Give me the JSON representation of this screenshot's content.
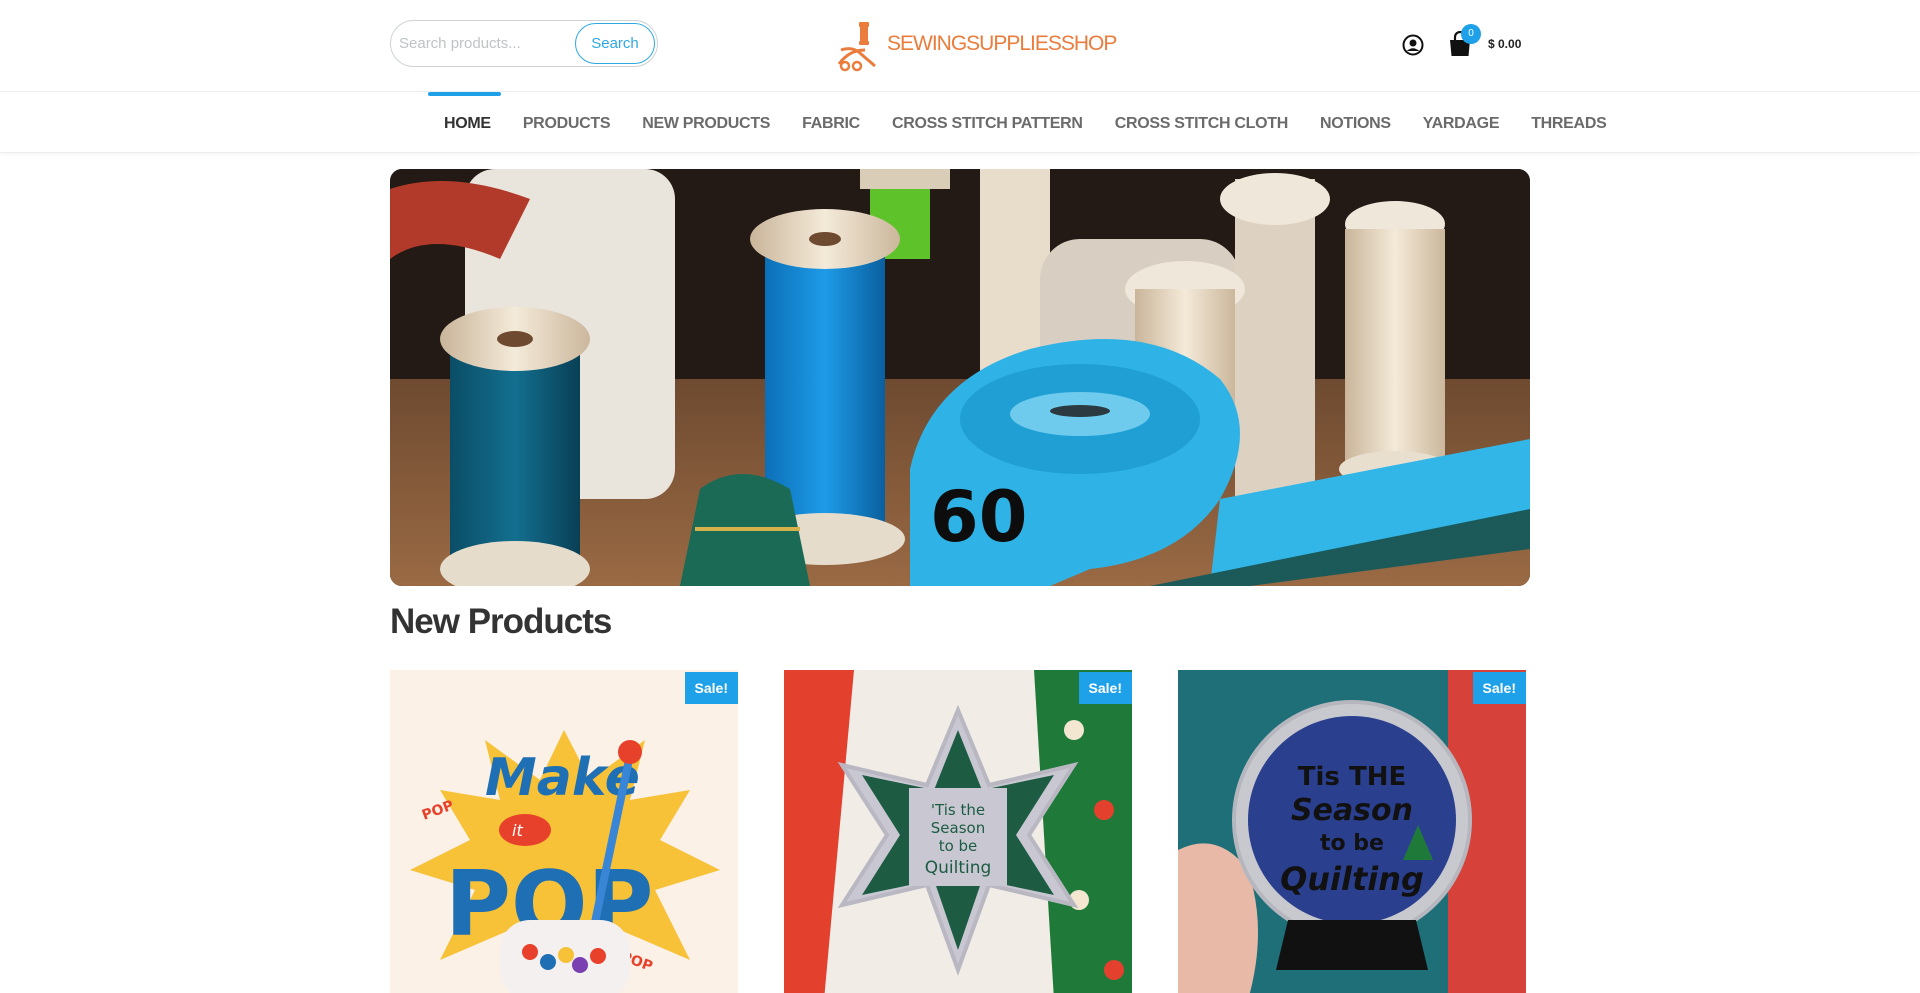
{
  "search": {
    "placeholder": "Search products...",
    "button_label": "Search"
  },
  "logo": {
    "text": "SEWINGSUPPLIESSHOP"
  },
  "cart": {
    "count": "0",
    "total": "$ 0.00"
  },
  "nav": {
    "items": [
      {
        "label": "HOME",
        "active": true
      },
      {
        "label": "PRODUCTS"
      },
      {
        "label": "NEW PRODUCTS"
      },
      {
        "label": "FABRIC"
      },
      {
        "label": "CROSS STITCH PATTERN"
      },
      {
        "label": "CROSS STITCH CLOTH"
      },
      {
        "label": "NOTIONS"
      },
      {
        "label": "YARDAGE"
      },
      {
        "label": "THREADS"
      }
    ]
  },
  "section": {
    "title": "New Products"
  },
  "products": [
    {
      "sale_label": "Sale!",
      "image_text": [
        "Make",
        "it",
        "POP",
        "POP",
        "POP"
      ]
    },
    {
      "sale_label": "Sale!",
      "image_text": [
        "'Tis the",
        "Season",
        "to be",
        "Quilting"
      ]
    },
    {
      "sale_label": "Sale!",
      "image_text": [
        "Tis THE",
        "Season",
        "to be",
        "Quilting"
      ]
    }
  ],
  "hero": {
    "tape_number": "60"
  },
  "colors": {
    "accent": "#1fa1ea",
    "logo": "#ea7c3c",
    "text": "#333333"
  },
  "icons": [
    "account-icon",
    "cart-icon"
  ]
}
